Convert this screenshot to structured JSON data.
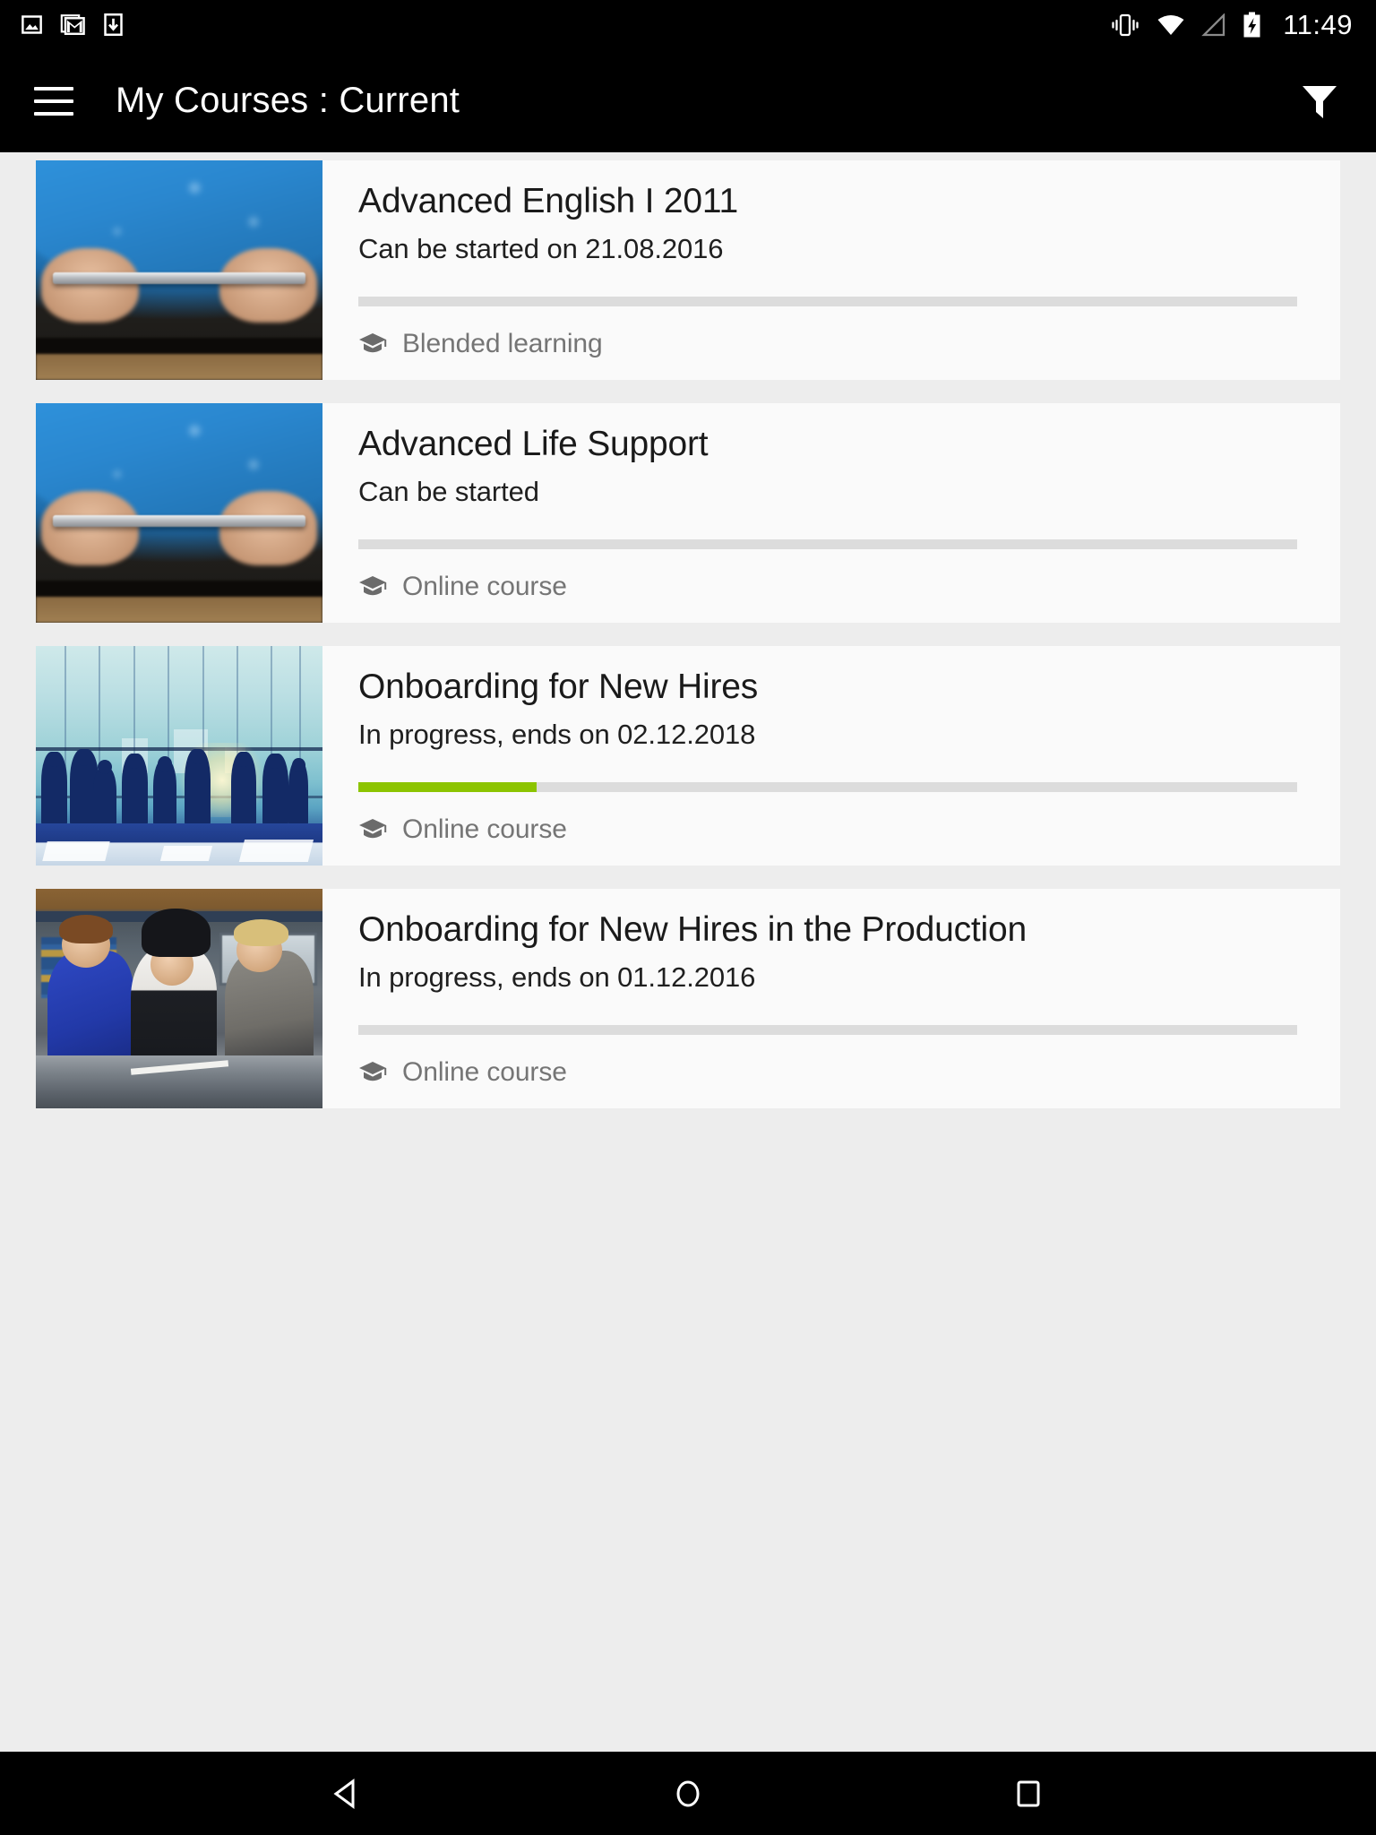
{
  "status_bar": {
    "left_icons": [
      "image-icon",
      "gmail-icon",
      "download-icon"
    ],
    "right_icons": [
      "vibrate-icon",
      "wifi-icon",
      "signal-icon",
      "battery-charging-icon"
    ],
    "time": "11:49"
  },
  "app_bar": {
    "menu_icon": "hamburger-menu-icon",
    "title": "My Courses : Current",
    "filter_icon": "filter-funnel-icon"
  },
  "colors": {
    "app_bar_bg": "#000000",
    "page_bg": "#ededed",
    "card_bg": "#fafafa",
    "progress_fill": "#8cc400",
    "progress_track": "#dcdcdc",
    "type_text": "#757575"
  },
  "courses": [
    {
      "title": "Advanced English I 2011",
      "status": "Can be started on 21.08.2016",
      "type": "Blended learning",
      "type_icon": "graduation-cap-icon",
      "progress_percent": 0,
      "thumbnail": "person-holding-tablet"
    },
    {
      "title": "Advanced Life Support",
      "status": "Can be started",
      "type": "Online course",
      "type_icon": "graduation-cap-icon",
      "progress_percent": 0,
      "thumbnail": "person-holding-tablet"
    },
    {
      "title": "Onboarding for New Hires",
      "status": "In progress, ends on 02.12.2018",
      "type": "Online course",
      "type_icon": "graduation-cap-icon",
      "progress_percent": 19,
      "thumbnail": "business-people-silhouettes"
    },
    {
      "title": "Onboarding for New Hires in the Production",
      "status": "In progress, ends on 01.12.2016",
      "type": "Online course",
      "type_icon": "graduation-cap-icon",
      "progress_percent": 0,
      "thumbnail": "workshop-training"
    }
  ],
  "nav_bar": {
    "back_label": "back-icon",
    "home_label": "home-icon",
    "recents_label": "recents-icon"
  }
}
